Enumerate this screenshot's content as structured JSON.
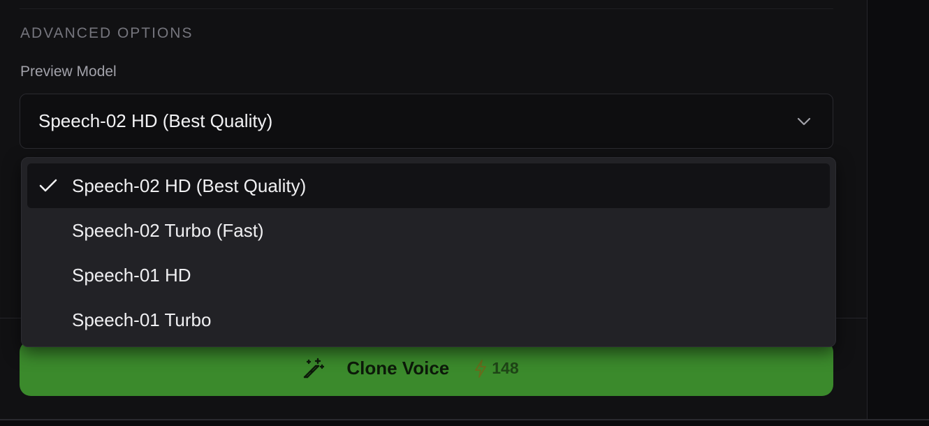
{
  "section": {
    "heading": "ADVANCED OPTIONS"
  },
  "preview_model": {
    "label": "Preview Model",
    "selected": "Speech-02 HD (Best Quality)",
    "options": [
      {
        "label": "Speech-02 HD (Best Quality)",
        "selected": true
      },
      {
        "label": "Speech-02 Turbo (Fast)",
        "selected": false
      },
      {
        "label": "Speech-01 HD",
        "selected": false
      },
      {
        "label": "Speech-01 Turbo",
        "selected": false
      }
    ]
  },
  "clone_button": {
    "label": "Clone Voice",
    "credits": "148",
    "icon": "magic-wand-icon",
    "credit_icon": "lightning-bolt-icon"
  },
  "colors": {
    "accent_green": "#3b8a2c",
    "panel_bg": "#111113",
    "dropdown_bg": "#222226",
    "selected_option_bg": "#121215"
  }
}
